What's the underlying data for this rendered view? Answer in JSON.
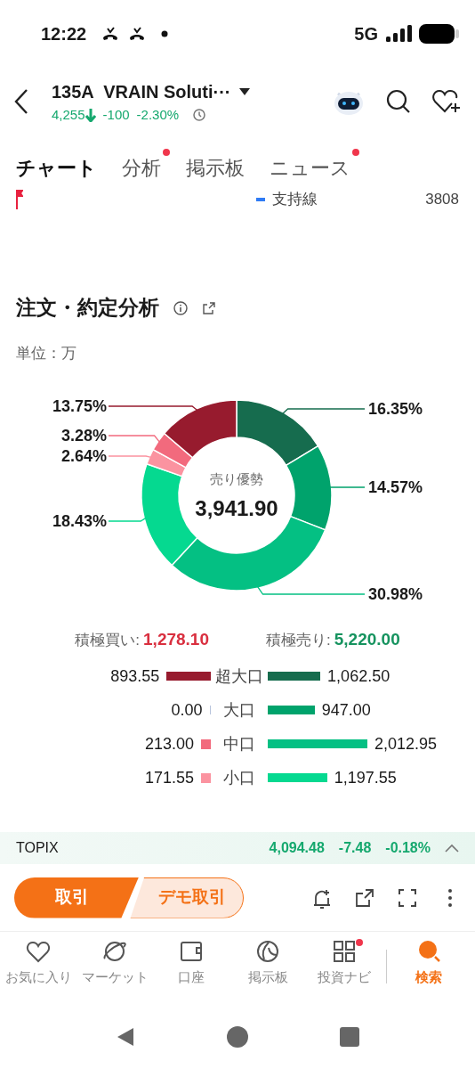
{
  "status_bar": {
    "time": "12:22",
    "network": "5G"
  },
  "header": {
    "title": "135A  VRAIN Soluti···",
    "price": "4,255",
    "change": "-100",
    "change_pct": "-2.30%"
  },
  "tabs": [
    {
      "label": "チャート",
      "selected": true,
      "dot": false
    },
    {
      "label": "分析",
      "selected": false,
      "dot": true
    },
    {
      "label": "掲示板",
      "selected": false,
      "dot": false
    },
    {
      "label": "ニュース",
      "selected": false,
      "dot": true
    }
  ],
  "legend": {
    "label": "支持線",
    "value": "3808"
  },
  "order_analysis": {
    "title": "注文・約定分析",
    "unit": "単位：万",
    "center_label": "売り優勢",
    "center_value": "3,941.90",
    "chart_data": {
      "type": "donut",
      "values": [
        16.35,
        14.57,
        30.98,
        18.43,
        2.64,
        3.28,
        13.75
      ],
      "value_labels": [
        "16.35%",
        "14.57%",
        "30.98%",
        "18.43%",
        "2.64%",
        "3.28%",
        "13.75%"
      ],
      "colors": [
        "#166c4e",
        "#00a36c",
        "#04c083",
        "#05d990",
        "#fb93a0",
        "#f26a7d",
        "#971b2e"
      ]
    },
    "summary": [
      {
        "kind": "buy",
        "label": "積極買い:",
        "value": "1,278.10"
      },
      {
        "kind": "sell",
        "label": "積極売り:",
        "value": "5,220.00"
      }
    ],
    "rows": [
      {
        "label": "超大口",
        "buy": {
          "value": "893.55",
          "color": "#971b2e"
        },
        "sell": {
          "value": "1,062.50",
          "color": "#166c4e"
        }
      },
      {
        "label": "大口",
        "buy": {
          "value": "0.00",
          "color": "#b8c4dc"
        },
        "sell": {
          "value": "947.00",
          "color": "#00a36c"
        }
      },
      {
        "label": "中口",
        "buy": {
          "value": "213.00",
          "color": "#f26a7d"
        },
        "sell": {
          "value": "2,012.95",
          "color": "#04c083"
        }
      },
      {
        "label": "小口",
        "buy": {
          "value": "171.55",
          "color": "#fb93a0"
        },
        "sell": {
          "value": "1,197.55",
          "color": "#05d990"
        }
      }
    ]
  },
  "ticker": {
    "name": "TOPIX",
    "value": "4,094.48",
    "change": "-7.48",
    "change_pct": "-0.18%"
  },
  "actions": {
    "trade": "取引",
    "demo": "デモ取引"
  },
  "bottom_nav": [
    {
      "kind": "heart",
      "label": "お気に入り",
      "selected": false,
      "dot": false
    },
    {
      "kind": "planet",
      "label": "マーケット",
      "selected": false,
      "dot": false
    },
    {
      "kind": "wallet",
      "label": "口座",
      "selected": false,
      "dot": false
    },
    {
      "kind": "board",
      "label": "掲示板",
      "selected": false,
      "dot": false
    },
    {
      "kind": "grid",
      "label": "投資ナビ",
      "selected": false,
      "dot": true
    },
    {
      "kind": "search",
      "label": "検索",
      "selected": true,
      "dot": false
    }
  ]
}
